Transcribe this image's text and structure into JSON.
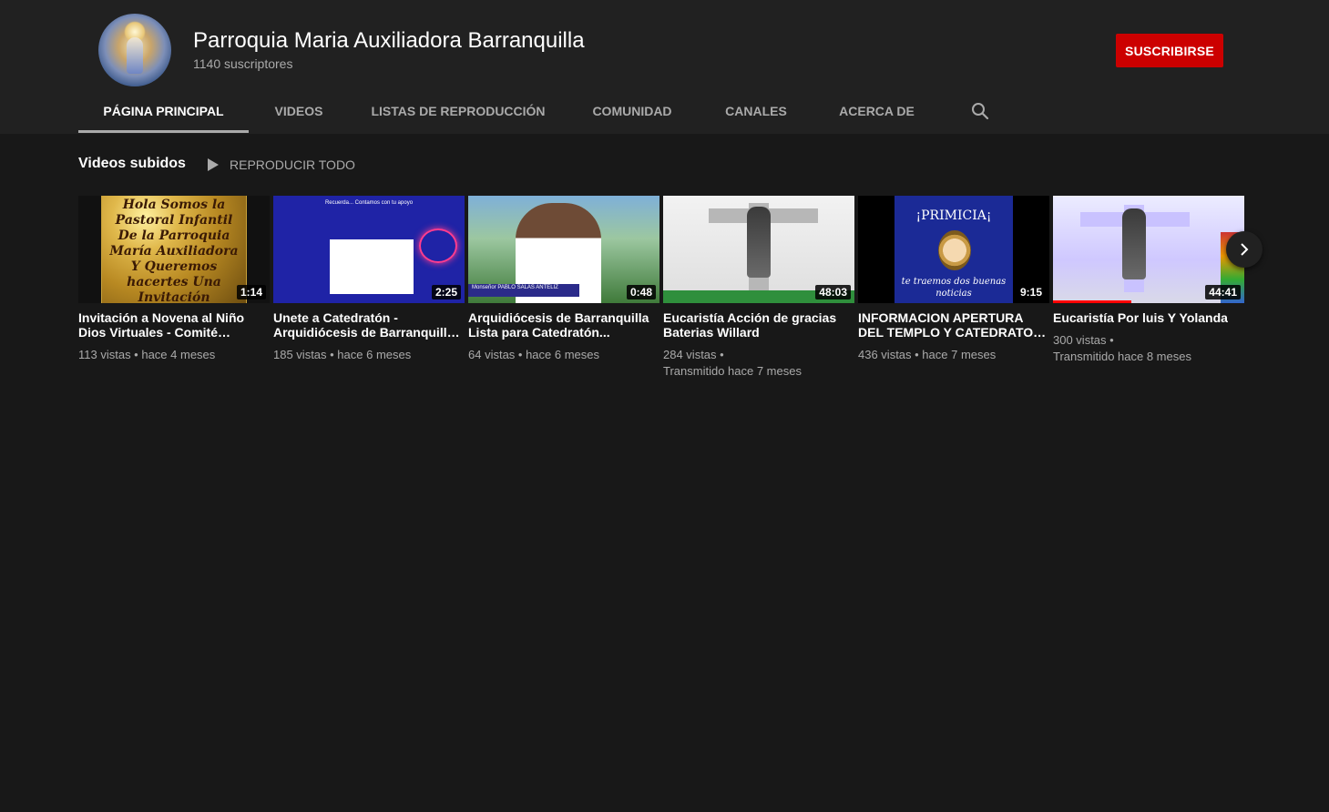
{
  "channel": {
    "name": "Parroquia Maria Auxiliadora Barranquilla",
    "subscribers": "1140 suscriptores",
    "subscribe_label": "SUSCRIBIRSE"
  },
  "tabs": [
    {
      "label": "PÁGINA PRINCIPAL",
      "active": true
    },
    {
      "label": "VIDEOS",
      "active": false
    },
    {
      "label": "LISTAS DE REPRODUCCIÓN",
      "active": false
    },
    {
      "label": "COMUNIDAD",
      "active": false
    },
    {
      "label": "CANALES",
      "active": false
    },
    {
      "label": "ACERCA DE",
      "active": false
    }
  ],
  "section": {
    "title": "Videos subidos",
    "play_all_label": "REPRODUCIR TODO"
  },
  "videos": [
    {
      "title": "Invitación a Novena al Niño\nDios Virtuales - Comité…",
      "meta": "113 vistas • hace 4 meses",
      "duration": "1:14",
      "thumb_text": "Hola Somos la Pastoral Infantil De la Parroquia María Auxiliadora Y Queremos hacertes Una Invitación"
    },
    {
      "title": "Unete a Catedratón -\nArquidiócesis de Barranquill…",
      "meta": "185 vistas • hace 6 meses",
      "duration": "2:25",
      "thumb_text": "Recuerda... Contamos con tu apoyo"
    },
    {
      "title": "Arquidiócesis de Barranquilla\nLista para Catedratón...",
      "meta": "64 vistas • hace 6 meses",
      "duration": "0:48",
      "thumb_text": "Monseñor PABLO SALAS ANTELIZ"
    },
    {
      "title": "Eucaristía Acción de gracias\nBaterias Willard",
      "meta_line1": "284 vistas •",
      "meta_line2": "Transmitido hace 7 meses",
      "duration": "48:03"
    },
    {
      "title": "INFORMACION APERTURA\nDEL TEMPLO Y CATEDRATO…",
      "meta": "436 vistas • hace 7 meses",
      "duration": "9:15",
      "thumb_head": "¡PRIMICIA¡",
      "thumb_foot": "te traemos dos buenas noticias"
    },
    {
      "title": "Eucaristía Por luis Y Yolanda",
      "meta_line1": "300 vistas •",
      "meta_line2": "Transmitido hace 8 meses",
      "duration": "44:41",
      "watched_progress": 0.41
    }
  ],
  "icons": {
    "search": "search-icon",
    "play": "play-icon",
    "next": "chevron-right-icon"
  },
  "colors": {
    "subscribe_bg": "#cc0000",
    "header_bg": "#212121",
    "page_bg": "#181818"
  }
}
